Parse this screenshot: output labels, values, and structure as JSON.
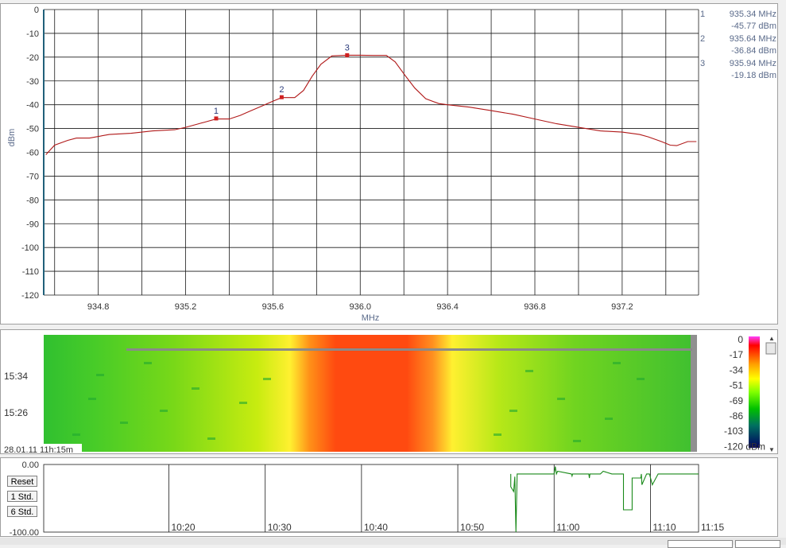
{
  "chart_data": [
    {
      "type": "line",
      "title": "",
      "xlabel": "MHz",
      "ylabel": "dBm",
      "xlim": [
        934.55,
        937.55
      ],
      "ylim": [
        -120,
        0
      ],
      "x_ticks": [
        "934.8",
        "935.2",
        "935.6",
        "936.0",
        "936.4",
        "936.8",
        "937.2"
      ],
      "y_ticks": [
        "0",
        "-10",
        "-20",
        "-30",
        "-40",
        "-50",
        "-60",
        "-70",
        "-80",
        "-90",
        "-100",
        "-110",
        "-120"
      ],
      "grid": true,
      "line_color": "#b01818",
      "series": [
        {
          "x": [
            934.56,
            934.6,
            934.66,
            934.7,
            934.76,
            934.85,
            934.95,
            935.05,
            935.15,
            935.2,
            935.26,
            935.3,
            935.34,
            935.4,
            935.45,
            935.5,
            935.55,
            935.6,
            935.64,
            935.7,
            935.74,
            935.78,
            935.82,
            935.87,
            935.94,
            936.0,
            936.06,
            936.12,
            936.16,
            936.2,
            936.25,
            936.3,
            936.36,
            936.4,
            936.5,
            936.6,
            936.7,
            936.8,
            936.9,
            937.0,
            937.1,
            937.2,
            937.28,
            937.32,
            937.38,
            937.42,
            937.45,
            937.5,
            937.54
          ],
          "y": [
            -61,
            -57,
            -55,
            -54,
            -54,
            -52.5,
            -52,
            -51,
            -50.5,
            -49.5,
            -48,
            -47,
            -46,
            -46,
            -44.5,
            -42.5,
            -40.5,
            -38.5,
            -37,
            -37,
            -34,
            -28,
            -23,
            -19.5,
            -19.2,
            -19.2,
            -19.3,
            -19.3,
            -22,
            -27,
            -33,
            -37.5,
            -39.5,
            -40,
            -41,
            -42.5,
            -44,
            -46,
            -48,
            -49.5,
            -51,
            -51.5,
            -52.5,
            -53.5,
            -55.5,
            -57,
            -57.2,
            -55.5,
            -55.5
          ]
        }
      ],
      "markers": [
        {
          "id": "1",
          "x": 935.34,
          "y": -45.77
        },
        {
          "id": "2",
          "x": 935.64,
          "y": -36.84
        },
        {
          "id": "3",
          "x": 935.94,
          "y": -19.18
        }
      ]
    },
    {
      "type": "heatmap",
      "title": "",
      "x_range": [
        934.55,
        937.55
      ],
      "time_labels": [
        "15:34",
        "15:26"
      ],
      "colorbar_ticks": [
        "0",
        "-17",
        "-34",
        "-51",
        "-69",
        "-86",
        "-103",
        "-120 dBm"
      ],
      "colorbar_range": [
        -120,
        0
      ],
      "colorbar_colors": [
        "#ff30ff",
        "#ff0000",
        "#ffa000",
        "#ffff00",
        "#80ff00",
        "#00c000",
        "#006060",
        "#000060"
      ]
    },
    {
      "type": "line",
      "title": "",
      "y_ticks": [
        "0.00",
        "-100.00"
      ],
      "ylim": [
        -100,
        0
      ],
      "x_ticks": [
        "10:20",
        "10:30",
        "10:40",
        "10:50",
        "11:00",
        "11:10",
        "11:15"
      ],
      "xlim": [
        10.1167,
        11.25
      ],
      "line_color": "#1a8a1a",
      "series": [
        {
          "x": [
            10.925,
            10.925,
            10.93,
            10.932,
            10.934,
            10.936,
            10.94,
            10.96,
            10.99,
            11.0,
            11.002,
            11.004,
            11.006,
            11.03,
            11.031,
            11.032,
            11.06,
            11.061,
            11.062,
            11.08,
            11.085,
            11.1,
            11.115,
            11.12,
            11.12,
            11.135,
            11.135,
            11.15,
            11.151,
            11.152,
            11.16,
            11.165,
            11.17,
            11.18,
            11.25
          ],
          "y": [
            -14,
            -33,
            -40,
            -18,
            -100,
            -14,
            -14,
            -14,
            -14,
            -14,
            -3,
            -14,
            -10,
            -14,
            -17,
            -14,
            -14,
            -20,
            -14,
            -14,
            -10,
            -14,
            -14,
            -14,
            -67,
            -67,
            -20,
            -20,
            -14,
            -30,
            -14,
            -14,
            -30,
            -14,
            -14
          ]
        }
      ]
    }
  ],
  "waterfall_timestamp": "28.01.11 11h:15m",
  "marker_readout": [
    {
      "id": "1",
      "freq": "935.34 MHz",
      "level": "-45.77 dBm"
    },
    {
      "id": "2",
      "freq": "935.64 MHz",
      "level": "-36.84 dBm"
    },
    {
      "id": "3",
      "freq": "935.94 MHz",
      "level": "-19.18 dBm"
    }
  ],
  "buttons": {
    "reset": "Reset",
    "std1": "1 Std.",
    "std6": "6 Std."
  },
  "colors": {
    "accent_grid": "#1a1a1a",
    "marker_color": "#d02020",
    "axis_line": "#20607a",
    "label_color": "#5a6a8a"
  }
}
